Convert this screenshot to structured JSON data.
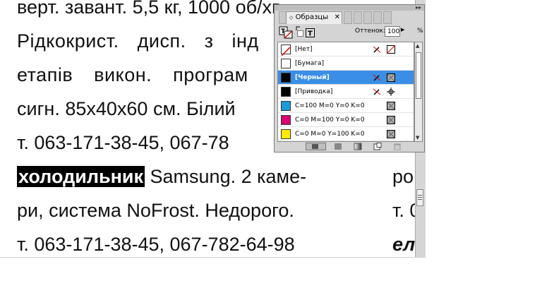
{
  "document": {
    "lines": [
      "верт. завант. 5,5 кг, 1000 об/хв",
      "Рідкокрист. дисп. з інд",
      "етапів викон. програм",
      "сигн. 85х40х60 см. Білий",
      "т. 063-171-38-45, 067-78",
      "холодильник",
      " Samsung. 2 каме-",
      "ри, система NoFrost. Недорого.",
      "т. 063-171-38-45, 067-782-64-98"
    ],
    "right_column": [
      "ро",
      "т. 0",
      "ел"
    ]
  },
  "swatches_panel": {
    "menu_arrows": "▸▸",
    "tabs": [
      "Образцы"
    ],
    "tab_close": "✕",
    "tint_label": "Оттенок:",
    "tint_value": "100",
    "tint_unit": "%",
    "swatches": [
      {
        "name": "[Нет]",
        "color": "#ffffff",
        "none": true
      },
      {
        "name": "[Бумага]",
        "color": "#ffffff"
      },
      {
        "name": "[Черный]",
        "color": "#000000",
        "selected": true
      },
      {
        "name": "[Приводка]",
        "color": "#000000"
      },
      {
        "name": "C=100 M=0 Y=0 K=0",
        "color": "#1a9bd7"
      },
      {
        "name": "C=0 M=100 Y=0 K=0",
        "color": "#d6006f"
      },
      {
        "name": "C=0 M=0 Y=100 K=0",
        "color": "#ffea00"
      }
    ]
  }
}
